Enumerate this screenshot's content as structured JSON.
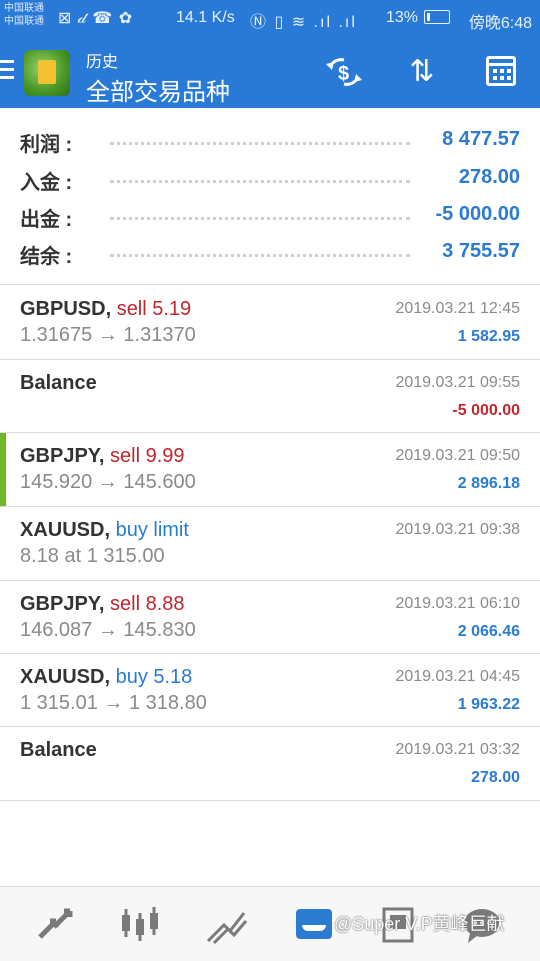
{
  "status_bar": {
    "carrier_1": "中国联通",
    "carrier_2": "中国联通",
    "notif_icons": "⊠ 𝒹 ☎ ✿",
    "speed": "14.1 K/s",
    "signal_icons": "Ⓝ ▯ ≋ .ıl .ıl",
    "battery": "13%",
    "time": "傍晚6:48"
  },
  "app_bar": {
    "title": "历史",
    "subtitle": "全部交易品种",
    "icon_fx": "$",
    "icon_sort": "⇅"
  },
  "summary": [
    {
      "label": "利润 :",
      "value": "8 477.57"
    },
    {
      "label": "入金 :",
      "value": "278.00"
    },
    {
      "label": "出金 :",
      "value": "-5 000.00"
    },
    {
      "label": "结余 :",
      "value": "3 755.57"
    }
  ],
  "trades": [
    {
      "symbol": "GBPUSD,",
      "action": "sell 5.19",
      "prices": "1.31675 → 1.31370",
      "time": "2019.03.21 12:45",
      "profit": "1 582.95"
    },
    {
      "symbol": "Balance",
      "action": "",
      "prices": "",
      "time": "2019.03.21 09:55",
      "profit": "-5 000.00"
    },
    {
      "symbol": "GBPJPY,",
      "action": "sell 9.99",
      "prices": "145.920 → 145.600",
      "time": "2019.03.21 09:50",
      "profit": "2 896.18"
    },
    {
      "symbol": "XAUUSD,",
      "action": "buy limit",
      "prices": "8.18 at 1 315.00",
      "time": "2019.03.21 09:38",
      "profit": ""
    },
    {
      "symbol": "GBPJPY,",
      "action": "sell 8.88",
      "prices": "146.087 → 145.830",
      "time": "2019.03.21 06:10",
      "profit": "2 066.46"
    },
    {
      "symbol": "XAUUSD,",
      "action": "buy 5.18",
      "prices": "1 315.01 → 1 318.80",
      "time": "2019.03.21 04:45",
      "profit": "1 963.22"
    },
    {
      "symbol": "Balance",
      "action": "",
      "prices": "",
      "time": "2019.03.21 03:32",
      "profit": "278.00"
    }
  ],
  "bottom_nav": {
    "watermark": "@Super V.P黄峰巨献"
  },
  "colors": {
    "accent_blue": "#2979d6",
    "sell_red": "#c0262d",
    "value_blue": "#2b7bd0",
    "highlight_green": "#6fb82a"
  }
}
